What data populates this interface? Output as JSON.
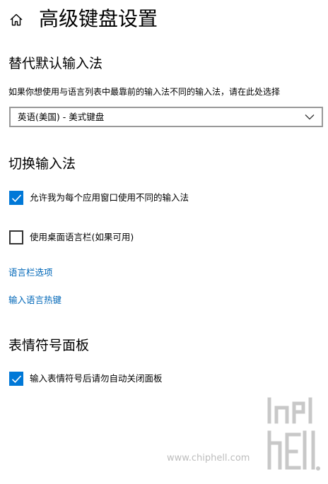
{
  "header": {
    "title": "高级键盘设置",
    "home_icon": "home-icon"
  },
  "override_input": {
    "title": "替代默认输入法",
    "description": "如果你想使用与语言列表中最靠前的输入法不同的输入法，请在此处选择",
    "dropdown_value": "英语(美国) - 美式键盘"
  },
  "switch_input": {
    "title": "切换输入法",
    "options": [
      {
        "label": "允许我为每个应用窗口使用不同的输入法",
        "checked": true
      },
      {
        "label": "使用桌面语言栏(如果可用)",
        "checked": false
      }
    ],
    "links": {
      "language_bar_options": "语言栏选项",
      "input_language_hotkeys": "输入语言热键"
    }
  },
  "emoji_panel": {
    "title": "表情符号面板",
    "options": [
      {
        "label": "输入表情符号后请勿自动关闭面板",
        "checked": true
      }
    ]
  },
  "watermark": {
    "site": "www.chiphell.com",
    "logo_text": "chiphell"
  },
  "colors": {
    "accent": "#0078d7",
    "link": "#0067b8",
    "dropdown_border": "#999999"
  }
}
